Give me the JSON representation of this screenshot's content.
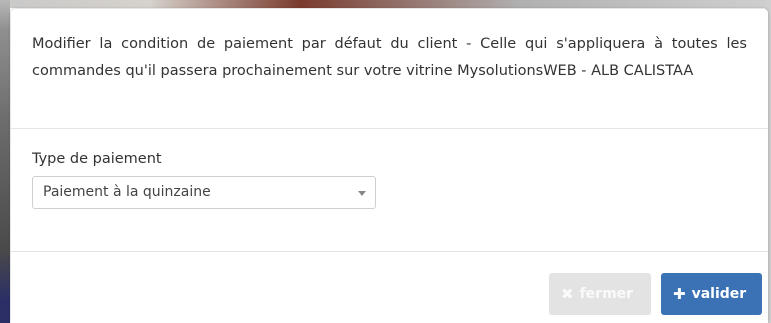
{
  "modal": {
    "description": "Modifier la condition de paiement par défaut du client - Celle qui s'appliquera à toutes les commandes qu'il passera prochainement sur votre vitrine MysolutionsWEB - ALB CALISTAA",
    "field": {
      "label": "Type de paiement",
      "selected_value": "Paiement à la quinzaine"
    },
    "buttons": {
      "close_icon": "times-icon",
      "close_label": "fermer",
      "validate_icon": "plus-icon",
      "validate_label": "valider"
    }
  },
  "colors": {
    "primary": "#3a72b5",
    "disabled": "#e3e3e3",
    "text": "#333333"
  }
}
